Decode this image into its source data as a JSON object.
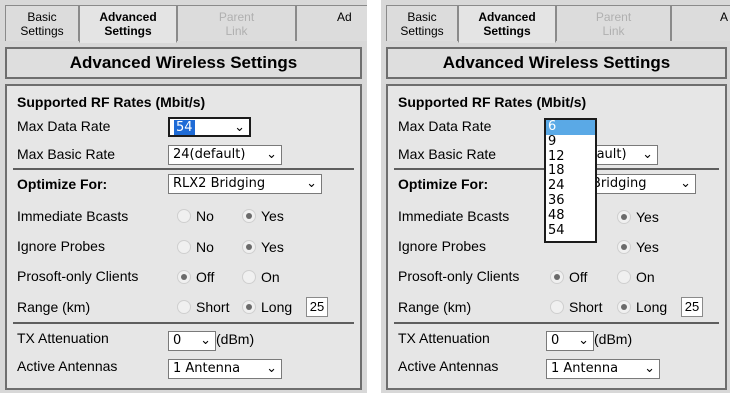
{
  "tabs": [
    {
      "line1": "Basic",
      "line2": "Settings"
    },
    {
      "line1": "Advanced",
      "line2": "Settings"
    },
    {
      "line1": "Parent",
      "line2": "Link"
    },
    {
      "line1": "Ad",
      "line2": ""
    }
  ],
  "tabs_right_partial": "A",
  "title": "Advanced Wireless Settings",
  "section_rf": "Supported RF Rates (Mbit/s)",
  "max_data_rate": {
    "label": "Max Data Rate",
    "value": "54"
  },
  "max_basic_rate": {
    "label": "Max Basic Rate",
    "value": "24(default)",
    "value_partial": "fault)"
  },
  "optimize_for": {
    "label": "Optimize For:",
    "value": "RLX2 Bridging",
    "value_partial": "Bridging"
  },
  "immediate_bcasts": {
    "label": "Immediate Bcasts",
    "no": "No",
    "yes": "Yes"
  },
  "ignore_probes": {
    "label": "Ignore Probes",
    "no": "No",
    "yes": "Yes"
  },
  "prosoft_only": {
    "label": "Prosoft-only Clients",
    "off": "Off",
    "on": "On"
  },
  "range": {
    "label": "Range (km)",
    "short": "Short",
    "long": "Long",
    "value": "25"
  },
  "tx_attenuation": {
    "label": "TX Attenuation",
    "value": "0",
    "unit": "(dBm)"
  },
  "active_antennas": {
    "label": "Active Antennas",
    "value": "1 Antenna"
  },
  "rate_options": [
    "6",
    "9",
    "12",
    "18",
    "24",
    "36",
    "48",
    "54"
  ],
  "rate_selected": "6",
  "icons": {
    "chevron": "chevron-down-icon",
    "radio": "radio-icon"
  }
}
